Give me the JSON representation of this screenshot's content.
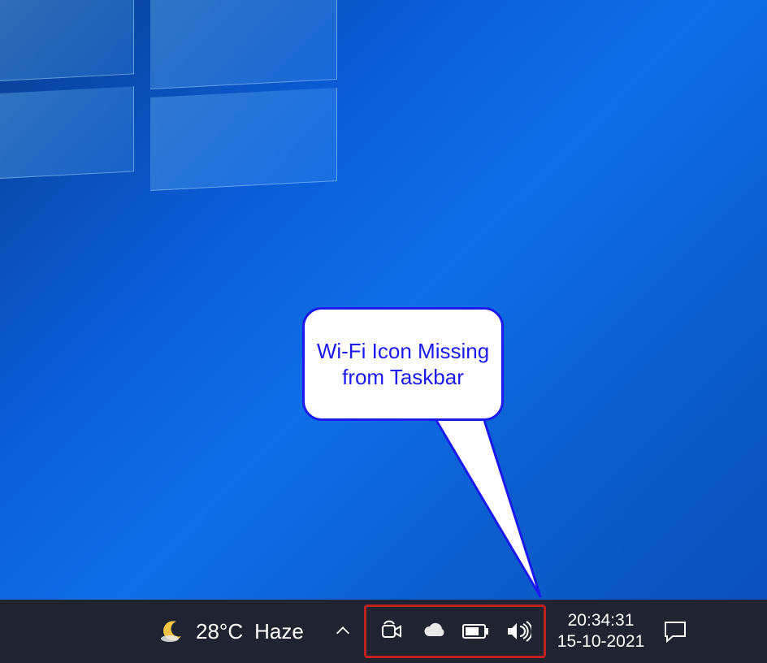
{
  "annotation": {
    "callout_text": "Wi-Fi Icon Missing from Taskbar"
  },
  "taskbar": {
    "weather": {
      "temperature": "28°C",
      "condition": "Haze"
    },
    "tray_icons": [
      "meet-now-icon",
      "onedrive-icon",
      "battery-icon",
      "volume-icon"
    ],
    "clock": {
      "time": "20:34:31",
      "date": "15-10-2021"
    }
  },
  "colors": {
    "callout_border": "#1a1af0",
    "highlight_border": "#c02020",
    "taskbar_bg": "#1f2430"
  }
}
